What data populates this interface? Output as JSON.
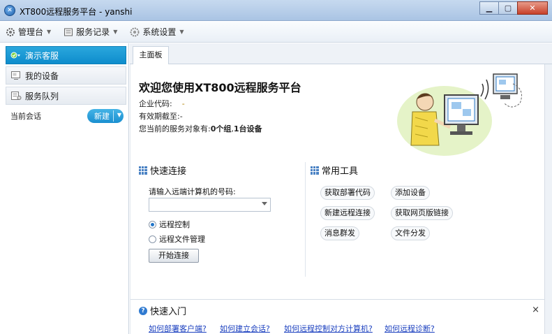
{
  "window": {
    "title": "XT800远程服务平台 - yanshi"
  },
  "toolbar": {
    "items": [
      {
        "label": "管理台"
      },
      {
        "label": "服务记录"
      },
      {
        "label": "系统设置"
      }
    ]
  },
  "sidebar": {
    "items": [
      {
        "label": "演示客服"
      },
      {
        "label": "我的设备"
      },
      {
        "label": "服务队列"
      }
    ],
    "session_label": "当前会话",
    "new_button": "新建"
  },
  "tabs": [
    {
      "label": "主面板"
    }
  ],
  "welcome": {
    "title": "欢迎您使用XT800远程服务平台",
    "enterprise_code_label": "企业代码:",
    "enterprise_code_value": "-",
    "expiry_label": "有效期截至:",
    "expiry_value": "-",
    "service_text_prefix": "您当前的服务对象有:",
    "groups": "0个组",
    "sep": ",",
    "devices": "1台设备"
  },
  "quick_connect": {
    "title": "快速连接",
    "prompt": "请输入远端计算机的号码:",
    "input_value": "",
    "options": [
      {
        "label": "远程控制",
        "selected": true
      },
      {
        "label": "远程文件管理",
        "selected": false
      }
    ],
    "start_button": "开始连接"
  },
  "tools": {
    "title": "常用工具",
    "buttons": [
      "获取部署代码",
      "添加设备",
      "新建远程连接",
      "获取网页版链接",
      "消息群发",
      "文件分发"
    ]
  },
  "quick_start": {
    "title": "快速入门",
    "close": "×",
    "links": [
      "如何部署客户端?",
      "如何建立会话?",
      "如何远程控制对方计算机?",
      "如何远程诊断?"
    ]
  },
  "colors": {
    "accent": "#1a8fd0",
    "link": "#1a3fbf",
    "window_chrome": "#aac4e4"
  }
}
